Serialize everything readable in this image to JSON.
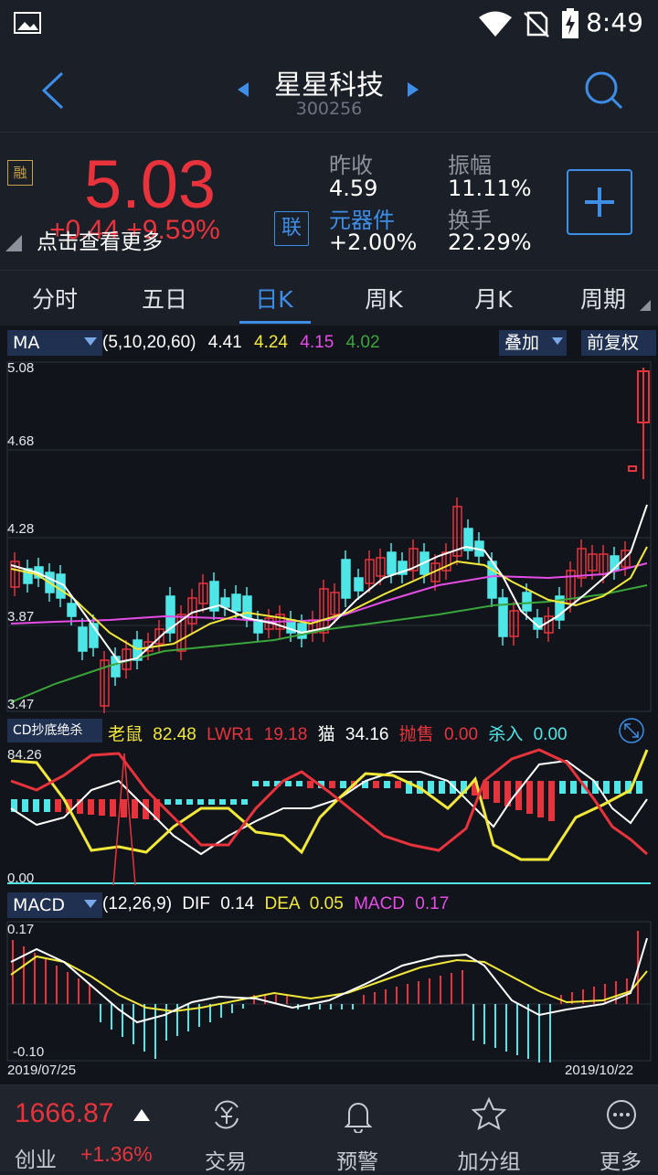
{
  "status": {
    "time": "8:49"
  },
  "header": {
    "title": "星星科技",
    "code": "300256"
  },
  "quote": {
    "badge": "融",
    "price": "5.03",
    "change_overlay": "点击查看更多",
    "change_behind": "+0.44 +9.59%",
    "link_badge": "联",
    "prev_close_label": "昨收",
    "prev_close": "4.59",
    "sector_label": "元器件",
    "sector_change": "+2.00%",
    "amplitude_label": "振幅",
    "amplitude": "11.11%",
    "turnover_label": "换手",
    "turnover": "22.29%",
    "add_icon": "plus-icon"
  },
  "tabs": [
    "分时",
    "五日",
    "日K",
    "周K",
    "月K",
    "周期"
  ],
  "ma": {
    "selector": "MA",
    "params": "(5,10,20,60)",
    "v5": "4.41",
    "v10": "4.24",
    "v20": "4.15",
    "v60": "4.02",
    "overlay": "叠加",
    "adjust": "前复权",
    "colors": {
      "ma5": "#ffffff",
      "ma10": "#f2e83a",
      "ma20": "#e64ce6",
      "ma60": "#3aa53a",
      "up": "#e8333c",
      "down": "#4ee6e6"
    }
  },
  "price_axis": [
    "5.08",
    "4.68",
    "4.28",
    "3.87",
    "3.47"
  ],
  "cd": {
    "selector": "CD抄底绝杀",
    "mouse_label": "老鼠",
    "mouse": "82.48",
    "lwr1_label": "LWR1",
    "lwr1": "19.18",
    "cat_label": "猫",
    "cat": "34.16",
    "sell_label": "抛售",
    "sell": "0.00",
    "kill_label": "杀入",
    "kill": "0.00",
    "axis_top": "84.26",
    "axis_bottom": "0.00"
  },
  "macd": {
    "selector": "MACD",
    "params": "(12,26,9)",
    "dif_label": "DIF",
    "dif": "0.14",
    "dea_label": "DEA",
    "dea": "0.05",
    "macd_label": "MACD",
    "macd": "0.17",
    "axis_top": "0.17",
    "axis_bottom": "-0.10",
    "date_start": "2019/07/25",
    "date_end": "2019/10/22"
  },
  "bottom": {
    "index_value": "1666.87",
    "index_name": "创业",
    "index_change": "+1.36%",
    "nav": [
      {
        "label": "交易",
        "icon": "yen-exchange-icon"
      },
      {
        "label": "预警",
        "icon": "bell-icon"
      },
      {
        "label": "加分组",
        "icon": "star-icon"
      },
      {
        "label": "更多",
        "icon": "more-dots-icon"
      }
    ]
  }
}
